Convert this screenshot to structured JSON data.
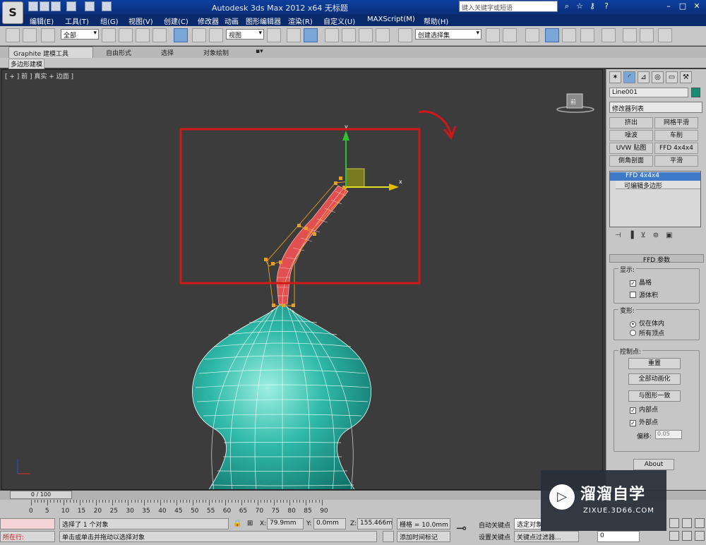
{
  "title_bar": {
    "title": "Autodesk 3ds Max  2012 x64      无标题",
    "search_placeholder": "键入关键字或短语",
    "help_icons": [
      "binoculars-icon",
      "star-icon",
      "key-icon",
      "tools-icon",
      "help-icon"
    ]
  },
  "menu": {
    "items": [
      "编辑(E)",
      "工具(T)",
      "组(G)",
      "视图(V)",
      "创建(C)",
      "修改器",
      "动画",
      "图形编辑器",
      "渲染(R)",
      "自定义(U)",
      "MAXScript(M)",
      "帮助(H)"
    ]
  },
  "toolbar": {
    "selection_filter": "全部",
    "reference_coord": "视图",
    "named_selection": "创建选择集"
  },
  "ribbon": {
    "tabs": [
      "Graphite 建模工具",
      "自由形式",
      "选择",
      "对象绘制"
    ],
    "subtab": "多边形建模"
  },
  "viewport": {
    "label": "[ + ] 前 ] 真实 + 边面 ]",
    "viewcube_label": "前",
    "gizmo_x": "x",
    "gizmo_y": "y"
  },
  "command_panel": {
    "object_name": "Line001",
    "modifier_list": "修改器列表",
    "modifier_buttons": [
      "挤出",
      "网格平滑",
      "噪波",
      "车削",
      "UVW 贴图",
      "FFD 4x4x4",
      "倒角剖面",
      "平滑"
    ],
    "stack": [
      "FFD 4x4x4",
      "可编辑多边形"
    ],
    "rollout_title": "FFD 参数",
    "display_group": "显示:",
    "lattice_label": "晶格",
    "lattice_checked": true,
    "source_volume_label": "源体积",
    "source_volume_checked": false,
    "deform_group": "变形:",
    "only_in_volume": "仅在体内",
    "all_vertices": "所有顶点",
    "control_points_group": "控制点:",
    "reset": "重置",
    "animate_all": "全部动画化",
    "conform_to_shape": "与图形一致",
    "inside_points": "内部点",
    "outside_points": "外部点",
    "offset_label": "偏移:",
    "offset_value": "0.05",
    "about": "About"
  },
  "timeline": {
    "frame_display": "0 / 100",
    "ruler_labels": [
      "0",
      "5",
      "10",
      "15",
      "20",
      "25",
      "30",
      "35",
      "40",
      "45",
      "50",
      "55",
      "60",
      "65",
      "70",
      "75",
      "80",
      "85",
      "90"
    ]
  },
  "status_bar": {
    "current_mode": "所在行:",
    "selection_info": "选择了 1 个对象",
    "prompt": "单击或单击并拖动以选择对象",
    "x_value": "79.9mm",
    "y_value": "0.0mm",
    "z_value": "155.466mm",
    "grid": "栅格 = 10.0mm",
    "add_time_tag": "添加时间标记",
    "auto_key": "自动关键点",
    "selected_set": "选定对象",
    "set_key": "设置关键点",
    "key_filters": "关键点过滤器...",
    "frame": "0"
  },
  "watermark": {
    "name": "溜溜自学",
    "url": "ZIXUE.3D66.COM"
  },
  "colors": {
    "highlight_box": "#d01818",
    "mesh_teal": "#2fb9a8",
    "selected_mesh": "#e05050",
    "active_button": "#7aa7d8"
  }
}
